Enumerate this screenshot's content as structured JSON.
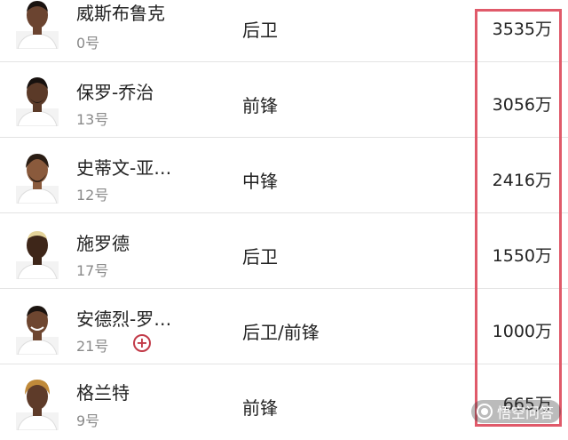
{
  "players": [
    {
      "name": "威斯布鲁克",
      "number": "0号",
      "position": "后卫",
      "salary": "3535万",
      "skin": "#6b4430",
      "hair": "#1a1310"
    },
    {
      "name": "保罗-乔治",
      "number": "13号",
      "position": "前锋",
      "salary": "3056万",
      "skin": "#5b3a28",
      "hair": "#17110e"
    },
    {
      "name": "史蒂文-亚…",
      "number": "12号",
      "position": "中锋",
      "salary": "2416万",
      "skin": "#8a5a3c",
      "hair": "#2a1d14"
    },
    {
      "name": "施罗德",
      "number": "17号",
      "position": "后卫",
      "salary": "1550万",
      "skin": "#3e2619",
      "hair": "#e4d39a"
    },
    {
      "name": "安德烈-罗…",
      "number": "21号",
      "position": "后卫/前锋",
      "salary": "1000万",
      "skin": "#6e4630",
      "hair": "#1c1410",
      "badge": "+"
    },
    {
      "name": "格兰特",
      "number": "9号",
      "position": "前锋",
      "salary": "665万",
      "skin": "#5e3b29",
      "hair": "#c08a3a"
    }
  ],
  "watermark": {
    "text": "悟空问答",
    "icon": "wukong-logo-icon"
  },
  "colors": {
    "highlight": "#e05a6a",
    "jersey": "#ffffff",
    "badge": "#c23a48"
  }
}
